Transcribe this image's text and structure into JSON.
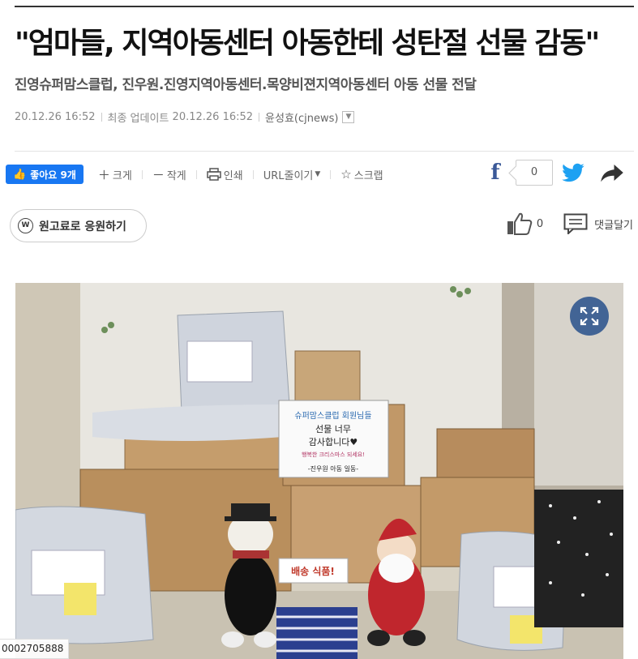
{
  "article": {
    "headline": "\"엄마들, 지역아동센터 아동한테 성탄절 선물 감동\"",
    "subhead": "진영슈퍼맘스클럽, 진우원.진영지역아동센터.목양비젼지역아동센터 아동 선물 전달",
    "published": "20.12.26 16:52",
    "updated_label": "최종 업데이트",
    "updated": "20.12.26 16:52",
    "author": "윤성효(cjnews)"
  },
  "toolbar": {
    "like_label": "좋아요 9개",
    "zoom_in": "크게",
    "zoom_out": "작게",
    "print": "인쇄",
    "shorten_url": "URL줄이기",
    "scrap": "스크랩"
  },
  "social": {
    "share_count": "0"
  },
  "support": {
    "label": "원고료로 응원하기",
    "coin": "W"
  },
  "reactions": {
    "like_count": "0",
    "comment_label": "댓글달기"
  },
  "photo": {
    "sign_lines": [
      "슈퍼맘스클럽 회원님들",
      "선물 너무",
      "감사합니다♥",
      "행복한 크리스마스 되세요!",
      "-진우원 아동 일동-"
    ],
    "box_text": "배송 식품!",
    "caption_tag": "0002705888"
  },
  "colors": {
    "facebook_like": "#1877f2",
    "facebook": "#3b5998",
    "twitter": "#1da1f2",
    "expand": "#28508c"
  }
}
